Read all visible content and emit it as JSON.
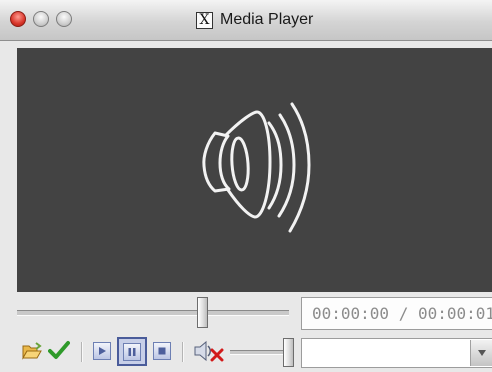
{
  "window": {
    "title": "Media Player",
    "app_icon_glyph": "X",
    "controls": [
      "close",
      "minimize",
      "zoom"
    ]
  },
  "video": {
    "placeholder_icon": "speaker-icon",
    "background": "#434343"
  },
  "seek": {
    "position_fraction": 0.69,
    "time_display": "00:00:00 / 00:00:01"
  },
  "toolbar": {
    "buttons": [
      {
        "name": "open",
        "icon": "folder-open-icon"
      },
      {
        "name": "accept",
        "icon": "green-check-icon"
      },
      {
        "name": "play",
        "icon": "play-icon"
      },
      {
        "name": "pause",
        "icon": "pause-icon",
        "active": true
      },
      {
        "name": "stop",
        "icon": "stop-icon"
      },
      {
        "name": "mute",
        "icon": "speaker-muted-icon"
      }
    ],
    "volume_fraction": 1.0,
    "combo_value": ""
  }
}
